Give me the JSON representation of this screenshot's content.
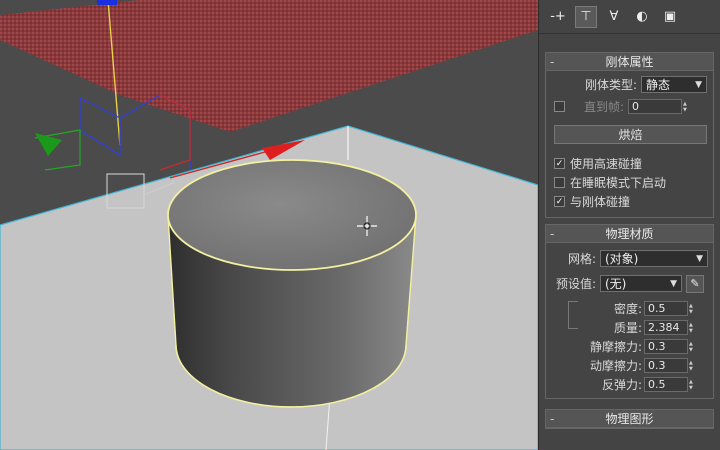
{
  "toolbar": {
    "tabs": [
      {
        "icon": "create-icon",
        "glyph": "-+",
        "active": false
      },
      {
        "icon": "modify-icon",
        "glyph": "⊤",
        "active": true
      },
      {
        "icon": "hierarchy-icon",
        "glyph": "∀",
        "active": false
      },
      {
        "icon": "motion-icon",
        "glyph": "◐",
        "active": false
      },
      {
        "icon": "display-icon",
        "glyph": "▣",
        "active": false
      }
    ]
  },
  "rigid_body": {
    "title": "刚体属性",
    "type_label": "刚体类型:",
    "type_value": "静态",
    "until_frame_label": "直到帧:",
    "until_frame_value": "0",
    "bake_button": "烘焙",
    "high_speed_label": "使用高速碰撞",
    "high_speed_checked": true,
    "sleep_label": "在睡眠模式下启动",
    "sleep_checked": false,
    "collide_label": "与刚体碰撞",
    "collide_checked": true
  },
  "physics_material": {
    "title": "物理材质",
    "mesh_label": "网格:",
    "mesh_value": "(对象)",
    "preset_label": "预设值:",
    "preset_value": "(无)",
    "density_label": "密度:",
    "density_value": "0.5",
    "mass_label": "质量:",
    "mass_value": "2.384",
    "static_friction_label": "静摩擦力:",
    "static_friction_value": "0.3",
    "dynamic_friction_label": "动摩擦力:",
    "dynamic_friction_value": "0.3",
    "bounce_label": "反弹力:",
    "bounce_value": "0.5"
  },
  "physics_shape": {
    "title": "物理图形"
  }
}
